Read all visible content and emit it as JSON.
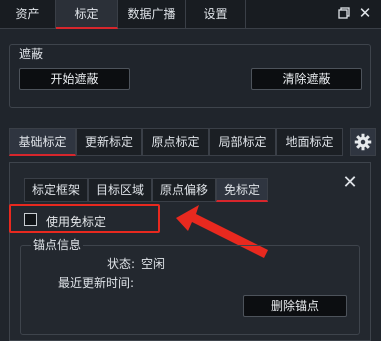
{
  "topnav": {
    "tabs": [
      {
        "label": "资产"
      },
      {
        "label": "标定"
      },
      {
        "label": "数据广播"
      },
      {
        "label": "设置"
      }
    ],
    "active_index": 1,
    "restore_icon": "window-restore-icon",
    "close_icon": "close-icon"
  },
  "mask": {
    "title": "遮蔽",
    "start_button": "开始遮蔽",
    "clear_button": "清除遮蔽"
  },
  "calib_tabs": {
    "tabs": [
      {
        "label": "基础标定"
      },
      {
        "label": "更新标定"
      },
      {
        "label": "原点标定"
      },
      {
        "label": "局部标定"
      },
      {
        "label": "地面标定"
      }
    ],
    "active_index": 0,
    "settings_icon": "gear-icon"
  },
  "sub_tabs": {
    "tabs": [
      {
        "label": "标定框架"
      },
      {
        "label": "目标区域"
      },
      {
        "label": "原点偏移"
      },
      {
        "label": "免标定"
      }
    ],
    "active_index": 3,
    "close_icon": "close-icon"
  },
  "free_calib": {
    "checkbox_label": "使用免标定",
    "checked": false
  },
  "anchor": {
    "title": "锚点信息",
    "status_label": "状态:",
    "status_value": "空闲",
    "last_update_label": "最近更新时间:",
    "delete_button": "删除锚点"
  },
  "colors": {
    "accent_red": "#d7262c",
    "annotation_red": "#e8291f",
    "background": "#20252c"
  }
}
